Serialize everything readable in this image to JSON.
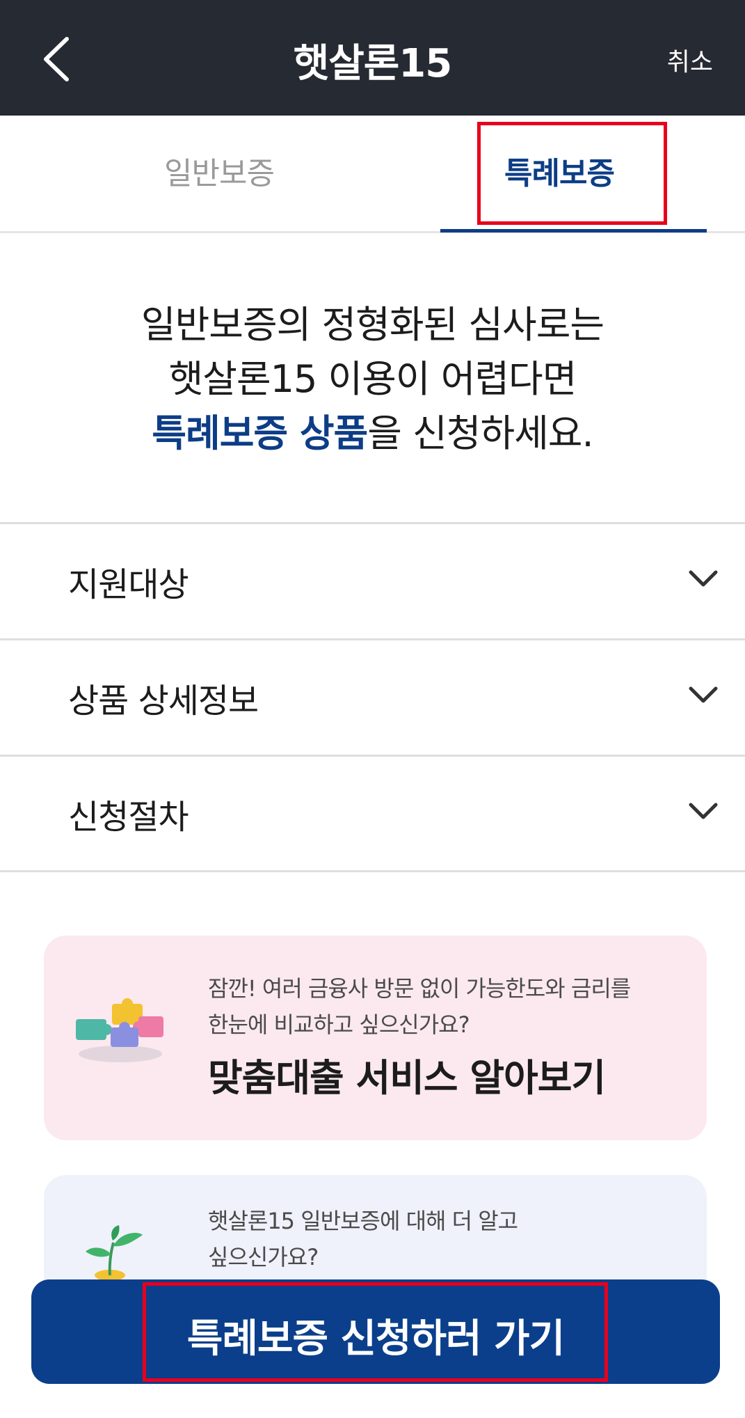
{
  "header": {
    "title": "햇살론15",
    "cancel_label": "취소",
    "back_icon": "chevron-left-icon"
  },
  "tabs": [
    {
      "label": "일반보증",
      "selected": false
    },
    {
      "label": "특례보증",
      "selected": true
    }
  ],
  "intro": {
    "line1": "일반보증의 정형화된 심사로는",
    "line2": "햇살론15 이용이 어렵다면",
    "line3_accent": "특례보증 상품",
    "line3_rest": "을 신청하세요."
  },
  "accordion": [
    {
      "label": "지원대상",
      "icon": "chevron-down-icon"
    },
    {
      "label": "상품 상세정보",
      "icon": "chevron-down-icon"
    },
    {
      "label": "신청절차",
      "icon": "chevron-down-icon"
    }
  ],
  "promo_cards": [
    {
      "sub_line1": "잠깐! 여러 금융사 방문 없이 가능한도와 금리를",
      "sub_line2": "한눈에 비교하고 싶으신가요?",
      "title": "맞춤대출 서비스 알아보기",
      "icon": "puzzle-icon",
      "background": "#fbe9ef"
    },
    {
      "sub_line1": "햇살론15 일반보증에 대해 더 알고",
      "sub_line2": "싶으신가요?",
      "icon": "sprout-icon",
      "background": "#eff1fb"
    }
  ],
  "cta": {
    "label": "특례보증 신청하러 가기"
  },
  "colors": {
    "header_bg": "#262a33",
    "accent": "#0d3d86",
    "cta_bg": "#0b3f8b",
    "highlight": "#e8001c"
  }
}
